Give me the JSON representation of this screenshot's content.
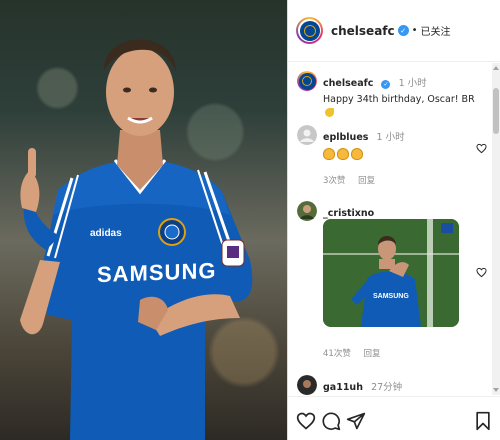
{
  "post": {
    "header": {
      "username": "chelseafc",
      "separator": "•",
      "follow_status": "已关注"
    },
    "caption": {
      "username": "chelseafc",
      "time": "1 小时",
      "text": "Happy 34th birthday, Oscar! BR"
    }
  },
  "photo": {
    "jersey_text": "SAMSUNG",
    "collar_brand": "adidas"
  },
  "comments": [
    {
      "username": "eplblues",
      "time": "1 小时",
      "emoji": [
        "clapping-hands",
        "clapping-hands",
        "clapping-hands"
      ],
      "likes": "3次赞",
      "reply": "回复"
    },
    {
      "username": "_cristixno",
      "time": "",
      "gif_jersey_text": "SAMSUNG",
      "likes": "41次赞",
      "reply": "回复"
    },
    {
      "username": "ga11uh",
      "time": "27分钟"
    }
  ],
  "action_bar": {
    "icons": [
      "heart-icon",
      "comment-icon",
      "share-icon",
      "bookmark-icon"
    ]
  },
  "colors": {
    "chelsea_blue": "#034694",
    "verified_blue": "#3897f0",
    "muted_text": "#8e8e8e"
  }
}
